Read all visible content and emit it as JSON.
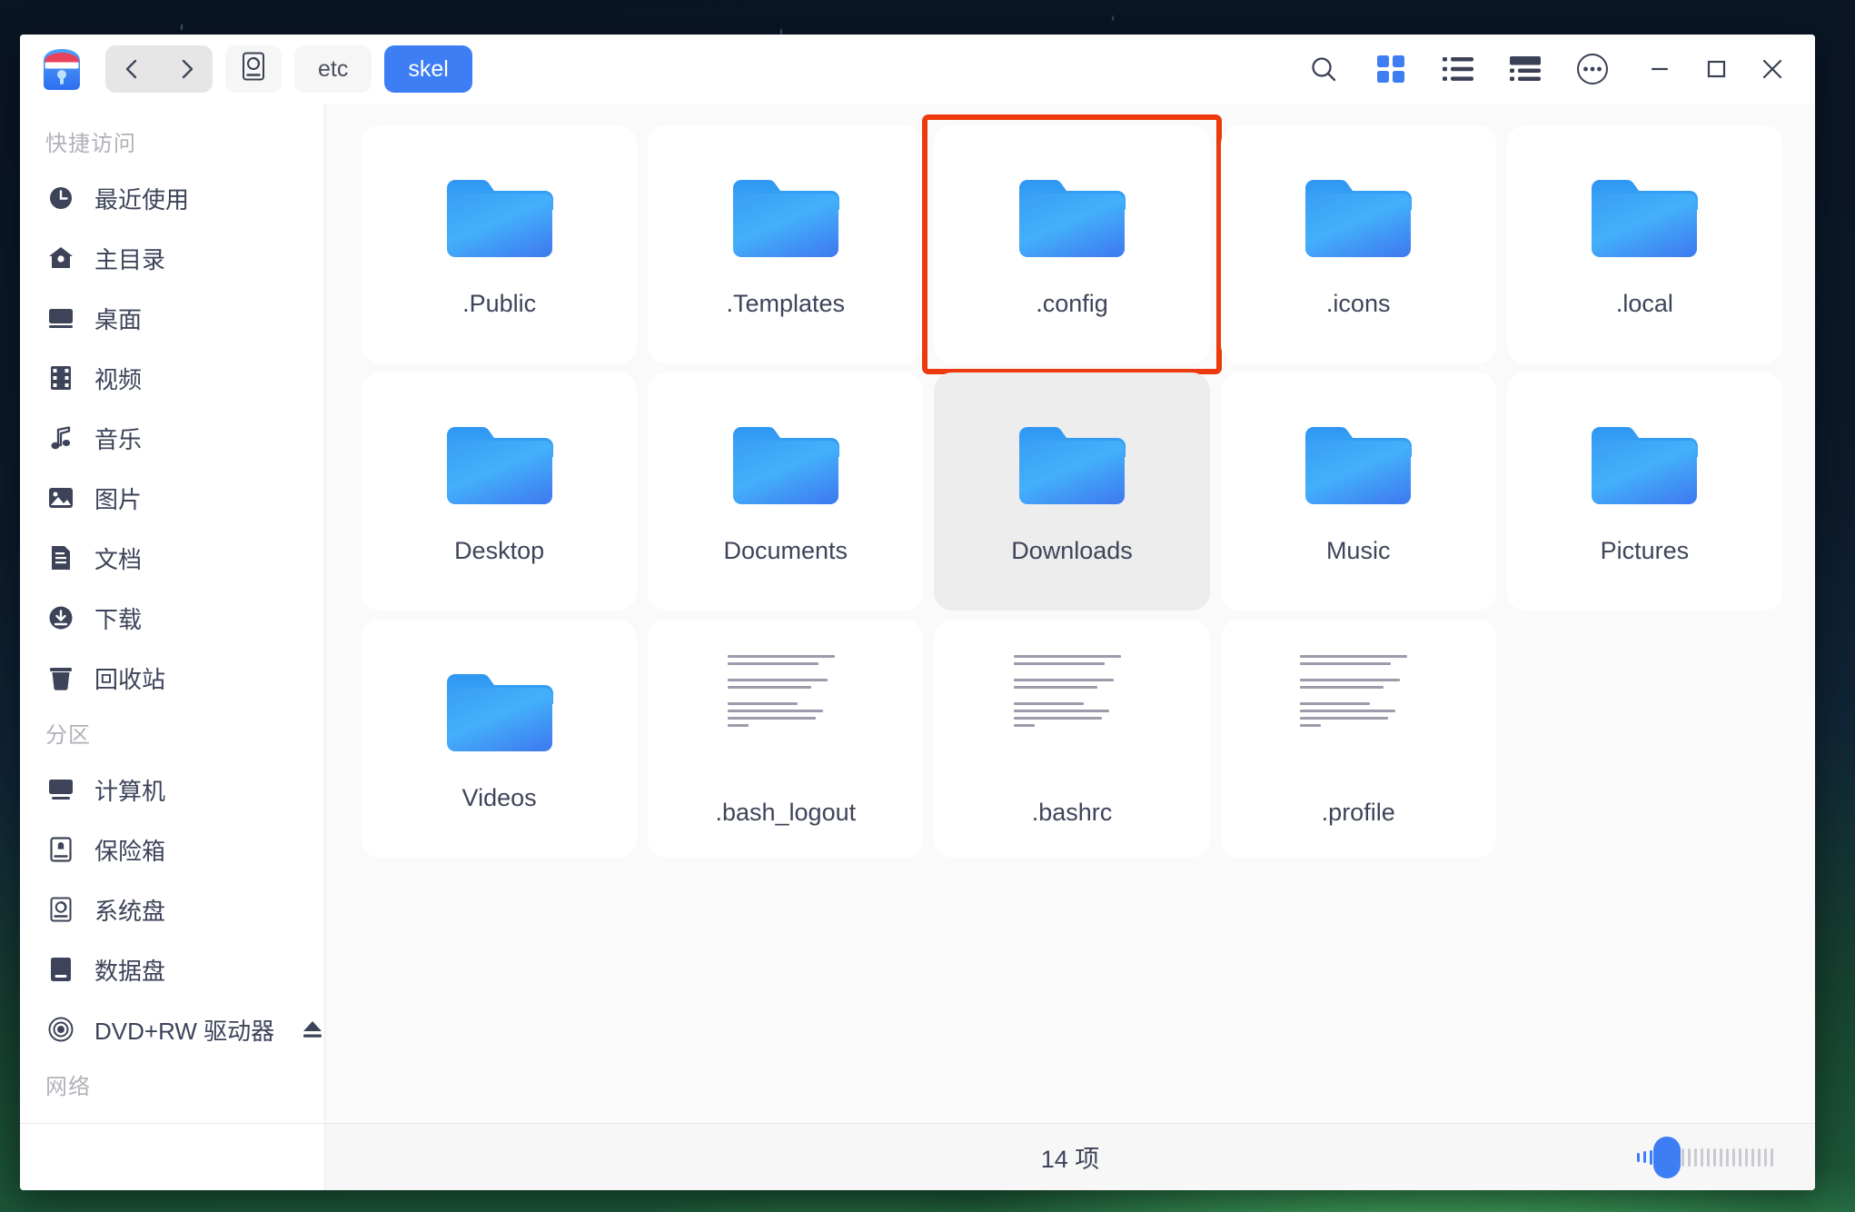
{
  "window": {
    "app_icon": "file-manager-icon",
    "nav": {
      "back": "back-arrow-icon",
      "forward": "forward-arrow-icon"
    },
    "breadcrumb": [
      {
        "icon": "disk-icon",
        "label": "",
        "active": false
      },
      {
        "icon": "",
        "label": "etc",
        "active": false
      },
      {
        "icon": "",
        "label": "skel",
        "active": true
      }
    ],
    "toolbar": [
      {
        "name": "search-icon",
        "label": "搜索",
        "active": false
      },
      {
        "name": "grid-view-icon",
        "label": "图标视图",
        "active": true
      },
      {
        "name": "list-view-icon",
        "label": "列表视图",
        "active": false
      },
      {
        "name": "detail-view-icon",
        "label": "详细视图",
        "active": false
      },
      {
        "name": "more-options-icon",
        "label": "更多选项",
        "active": false
      }
    ],
    "controls": {
      "minimize": "minimize-icon",
      "maximize": "maximize-icon",
      "close": "close-icon"
    },
    "accent_color": "#3d7ef5",
    "highlight_color": "#ec3a0d"
  },
  "sidebar": {
    "sections": [
      {
        "title": "快捷访问",
        "items": [
          {
            "icon": "clock-icon",
            "label": "最近使用"
          },
          {
            "icon": "home-icon",
            "label": "主目录"
          },
          {
            "icon": "desktop-icon",
            "label": "桌面"
          },
          {
            "icon": "film-icon",
            "label": "视频"
          },
          {
            "icon": "music-icon",
            "label": "音乐"
          },
          {
            "icon": "image-icon",
            "label": "图片"
          },
          {
            "icon": "document-icon",
            "label": "文档"
          },
          {
            "icon": "download-icon",
            "label": "下载"
          },
          {
            "icon": "trash-icon",
            "label": "回收站"
          }
        ]
      },
      {
        "title": "分区",
        "items": [
          {
            "icon": "computer-icon",
            "label": "计算机"
          },
          {
            "icon": "safebox-icon",
            "label": "保险箱"
          },
          {
            "icon": "systemdisk-icon",
            "label": "系统盘"
          },
          {
            "icon": "datadisk-icon",
            "label": "数据盘"
          },
          {
            "icon": "disc-icon",
            "label": "DVD+RW 驱动器",
            "eject": "eject-icon"
          }
        ]
      },
      {
        "title": "网络",
        "items": []
      }
    ]
  },
  "files": [
    {
      "name": ".Public",
      "type": "folder",
      "state": "normal"
    },
    {
      "name": ".Templates",
      "type": "folder",
      "state": "normal"
    },
    {
      "name": ".config",
      "type": "folder",
      "state": "marked"
    },
    {
      "name": ".icons",
      "type": "folder",
      "state": "normal"
    },
    {
      "name": ".local",
      "type": "folder",
      "state": "normal"
    },
    {
      "name": "Desktop",
      "type": "folder",
      "state": "normal"
    },
    {
      "name": "Documents",
      "type": "folder",
      "state": "normal"
    },
    {
      "name": "Downloads",
      "type": "folder",
      "state": "hover"
    },
    {
      "name": "Music",
      "type": "folder",
      "state": "normal"
    },
    {
      "name": "Pictures",
      "type": "folder",
      "state": "normal"
    },
    {
      "name": "Videos",
      "type": "folder",
      "state": "normal"
    },
    {
      "name": ".bash_logout",
      "type": "text",
      "state": "normal"
    },
    {
      "name": ".bashrc",
      "type": "text",
      "state": "normal"
    },
    {
      "name": ".profile",
      "type": "text",
      "state": "normal"
    }
  ],
  "statusbar": {
    "item_count_label": "14 项",
    "zoom_level": 25
  }
}
